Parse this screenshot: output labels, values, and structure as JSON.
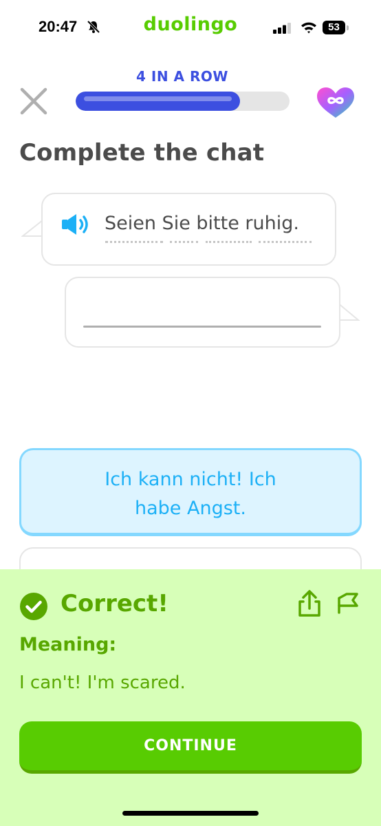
{
  "status_bar": {
    "time": "20:47",
    "brand": "duolingo",
    "battery": "53",
    "icons": [
      "bell-slash-icon",
      "signal-icon",
      "wifi-icon",
      "battery-icon"
    ]
  },
  "header": {
    "streak_label": "4 IN A ROW",
    "progress_fraction": 0.77,
    "close_icon": "close-icon",
    "hearts_icon": "infinity-heart-icon"
  },
  "exercise": {
    "title": "Complete the chat",
    "prompt": "Seien Sie bitte ruhig.",
    "prompt_icon": "speaker-icon",
    "answer": ""
  },
  "options": [
    {
      "label": "Ich kann nicht! Ich habe Angst.",
      "line1": "Ich kann nicht! Ich",
      "line2": "habe Angst.",
      "selected": true
    }
  ],
  "feedback": {
    "status": "Correct!",
    "meaning_label": "Meaning:",
    "meaning": "I can't! I'm scared.",
    "continue_label": "CONTINUE"
  },
  "colors": {
    "brand_green": "#58cc02",
    "dark_green": "#58a700",
    "panel_green": "#d7ffb8",
    "progress_blue": "#3c4fe0",
    "selected_blue": "#1cb0f6",
    "selected_bg": "#ddf4ff"
  }
}
